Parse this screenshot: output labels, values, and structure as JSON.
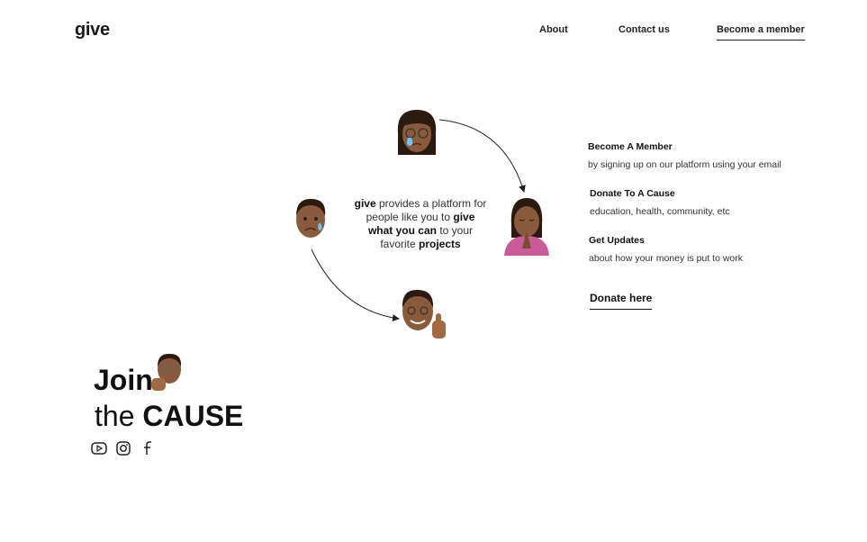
{
  "header": {
    "logo": "give",
    "nav": {
      "about": "About",
      "contact": "Contact us",
      "member": "Become a member"
    }
  },
  "center": {
    "brand": "give",
    "t1": " provides a platform for people like you to ",
    "highlight": "give what you can",
    "t2": " to your favorite ",
    "projects": "projects"
  },
  "steps": [
    {
      "title": "Become A Member",
      "desc": "by signing up on our platform using your email"
    },
    {
      "title": "Donate To A Cause",
      "desc": "education, health, community, etc"
    },
    {
      "title": "Get Updates",
      "desc": "about how your money is put to work"
    }
  ],
  "cta": {
    "donate": "Donate here"
  },
  "hero": {
    "join": "Join",
    "the": "the",
    "cause": "CAUSE"
  },
  "social_icons": [
    "youtube-icon",
    "instagram-icon",
    "facebook-icon"
  ],
  "colors": {
    "text": "#1a1a1a",
    "skin": "#8a5a3c",
    "hair": "#2b1a10",
    "shirt": "#c95c98"
  }
}
